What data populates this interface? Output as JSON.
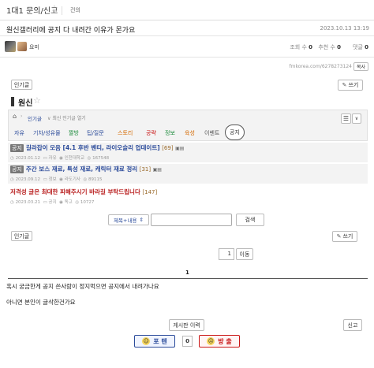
{
  "header": {
    "board": "1대1 문의/신고",
    "sub": "건의"
  },
  "post": {
    "title": "원신갤러리에 공지 다 내려간 이유가 몬가요",
    "date": "2023.10.13 13:19",
    "author": "요미",
    "views_label": "조회 수",
    "views": "0",
    "recs_label": "추천 수",
    "recs": "0",
    "comments_label": "댓글",
    "comments": "0",
    "copy_label": "복사",
    "url": "fmkorea.com/6278273124"
  },
  "embed": {
    "popular_label": "인기글",
    "write_label": "쓰기",
    "board_title": "원신",
    "breadcrumb_popular": "인기글",
    "breadcrumb_hint": "최신 인기글 열기",
    "tabs": [
      "자유",
      "기차/성유물",
      "짤방",
      "팁/질문",
      "스토리",
      "공략",
      "정보",
      "육성",
      "이벤트",
      "공지"
    ],
    "tab_colors": [
      "#2a4a9a",
      "#2a4a9a",
      "#1a8a3a",
      "#2a4a9a",
      "#d46a00",
      "#c91515",
      "#1a8a3a",
      "#d46a00",
      "#555555",
      "#333333"
    ],
    "posts": [
      {
        "badge": "공지",
        "title": "길라잡이 모음 [4.1 후반 벤티, 라이오슬리 업데이트]",
        "count": "[69]",
        "date": "2023.01.12",
        "cat": "자유",
        "author": "인천대학교",
        "views": "167548"
      },
      {
        "badge": "공지",
        "title": "주간 보스 재료, 특성 재료, 캐릭터 재료 정리",
        "count": "[31]",
        "date": "2023.09.12",
        "cat": "정보",
        "author": "라도기사",
        "views": "89115"
      },
      {
        "badge": "",
        "title": "저격성 글은 최대한 피해주시기 바라길 부탁드립니다",
        "count": "[147]",
        "date": "2023.03.21",
        "cat": "공지",
        "author": "독고",
        "views": "10727"
      }
    ],
    "search_option": "제목+내용",
    "search_button": "검색",
    "popular_label2": "인기글",
    "write_label2": "쓰기",
    "page_input": "1",
    "page_go": "이동",
    "page_num": "1"
  },
  "body": {
    "line1": "혹시 궁금한게 공지 쓴사람이 정지먹으면 공지에서 내려가나요",
    "line2": "아니면 본인이 글삭한건가요"
  },
  "footer": {
    "list_button": "게시판 이력",
    "report_button": "신고",
    "vote_up": "포 텐",
    "vote_count": "0",
    "vote_down": "방 출"
  }
}
